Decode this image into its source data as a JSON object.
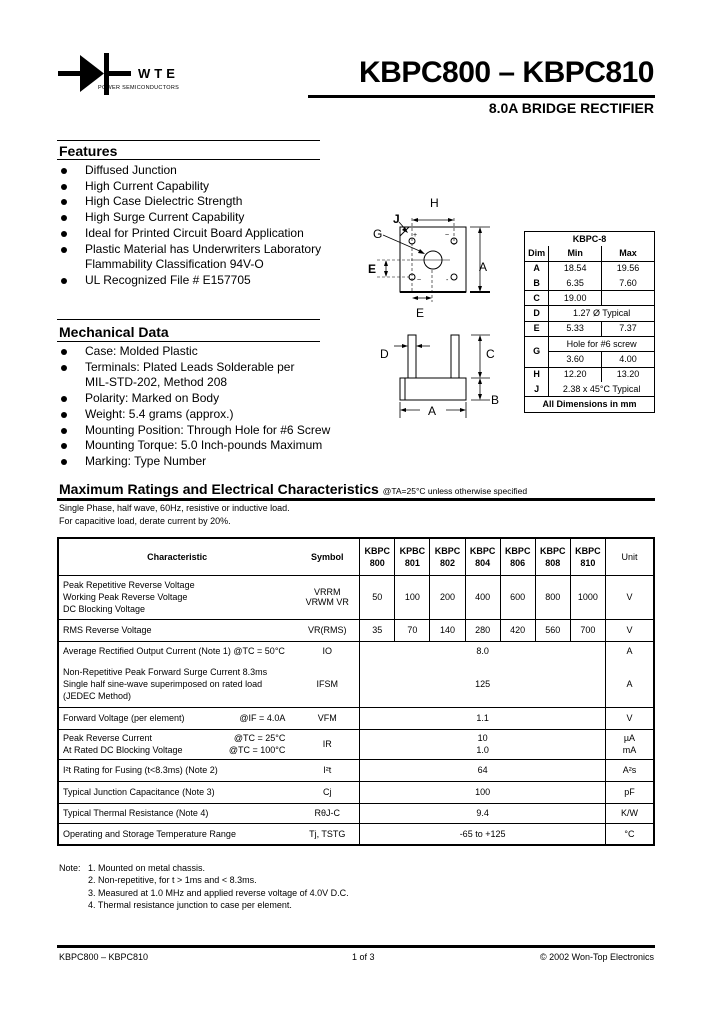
{
  "header": {
    "logo_text": "WTE",
    "logo_subtext": "POWER SEMICONDUCTORS",
    "title": "KBPC800 – KBPC810",
    "subtitle": "8.0A BRIDGE RECTIFIER"
  },
  "features": {
    "title": "Features",
    "items": [
      "Diffused Junction",
      "High Current Capability",
      "High Case Dielectric Strength",
      "High Surge Current Capability",
      "Ideal for Printed Circuit Board Application",
      "Plastic Material has Underwriters Laboratory\nFlammability Classification 94V-O",
      "UL Recognized File # E157705"
    ]
  },
  "mechanical": {
    "title": "Mechanical Data",
    "items": [
      "Case: Molded Plastic",
      "Terminals: Plated Leads Solderable per\nMIL-STD-202, Method 208",
      "Polarity: Marked on Body",
      "Weight: 5.4 grams (approx.)",
      "Mounting Position: Through Hole for #6 Screw",
      "Mounting Torque: 5.0 Inch-pounds Maximum",
      "Marking: Type Number"
    ]
  },
  "diagram": {
    "labels": {
      "H": "H",
      "J": "J",
      "G": "G",
      "E": "E",
      "A": "A",
      "D": "D",
      "C": "C",
      "B": "B"
    },
    "pin_marks": {
      "plus": "+",
      "tilde1": "~",
      "tilde2": "~",
      "minus": "-"
    }
  },
  "dim_table": {
    "package": "KBPC-8",
    "headers": [
      "Dim",
      "Min",
      "Max"
    ],
    "rows": [
      {
        "dim": "A",
        "min": "18.54",
        "max": "19.56"
      },
      {
        "dim": "B",
        "min": "6.35",
        "max": "7.60"
      },
      {
        "dim": "C",
        "min": "19.00",
        "max": ""
      },
      {
        "dim": "D",
        "span": "1.27 Ø Typical"
      },
      {
        "dim": "E",
        "min": "5.33",
        "max": "7.37"
      },
      {
        "dim": "G",
        "span": "Hole for #6 screw",
        "min": "3.60",
        "max": "4.00"
      },
      {
        "dim": "H",
        "min": "12.20",
        "max": "13.20"
      },
      {
        "dim": "J",
        "span": "2.38 x 45°C Typical"
      }
    ],
    "footer": "All Dimensions in mm"
  },
  "ratings": {
    "title": "Maximum Ratings and Electrical Characteristics",
    "condition": "@TA=25°C unless otherwise specified",
    "note1": "Single Phase, half wave, 60Hz, resistive or inductive load.",
    "note2": "For capacitive load, derate current by 20%.",
    "table": {
      "col_characteristic": "Characteristic",
      "col_symbol": "Symbol",
      "col_unit": "Unit",
      "parts": [
        {
          "l1": "KBPC",
          "l2": "800"
        },
        {
          "l1": "KPBC",
          "l2": "801"
        },
        {
          "l1": "KBPC",
          "l2": "802"
        },
        {
          "l1": "KBPC",
          "l2": "804"
        },
        {
          "l1": "KBPC",
          "l2": "806"
        },
        {
          "l1": "KBPC",
          "l2": "808"
        },
        {
          "l1": "KBPC",
          "l2": "810"
        }
      ],
      "rows": [
        {
          "char": [
            "Peak Repetitive Reverse Voltage",
            "Working Peak Reverse Voltage",
            "DC Blocking Voltage"
          ],
          "sym": [
            "VRRM",
            "VRWM",
            "VR"
          ],
          "values": [
            "50",
            "100",
            "200",
            "400",
            "600",
            "800",
            "1000"
          ],
          "unit": "V"
        },
        {
          "char": [
            "RMS Reverse Voltage"
          ],
          "sym": [
            "VR(RMS)"
          ],
          "values": [
            "35",
            "70",
            "140",
            "280",
            "420",
            "560",
            "700"
          ],
          "unit": "V"
        },
        {
          "char": [
            "Average Rectified Output Current (Note 1)  @TC = 50°C"
          ],
          "sym": [
            "IO"
          ],
          "value": "8.0",
          "unit": "A"
        },
        {
          "char": [
            "Non-Repetitive Peak Forward Surge Current 8.3ms",
            "Single half sine-wave superimposed on rated load",
            "(JEDEC Method)"
          ],
          "sym": [
            "IFSM"
          ],
          "value": "125",
          "unit": "A"
        },
        {
          "char": [
            "Forward Voltage (per element)"
          ],
          "cond": [
            "@IF = 4.0A"
          ],
          "sym": [
            "VFM"
          ],
          "value": "1.1",
          "unit": "V"
        },
        {
          "char": [
            "Peak Reverse Current",
            "At Rated DC Blocking Voltage"
          ],
          "cond": [
            "@TC = 25°C",
            "@TC = 100°C"
          ],
          "sym": [
            "IR"
          ],
          "value": "10\n1.0",
          "unit": "µA\nmA"
        },
        {
          "char": [
            "I²t Rating for Fusing (t<8.3ms) (Note 2)"
          ],
          "sym": [
            "I²t"
          ],
          "value": "64",
          "unit": "A²s"
        },
        {
          "char": [
            "Typical Junction Capacitance (Note 3)"
          ],
          "sym": [
            "Cj"
          ],
          "value": "100",
          "unit": "pF"
        },
        {
          "char": [
            "Typical Thermal Resistance (Note 4)"
          ],
          "sym": [
            "RθJ-C"
          ],
          "value": "9.4",
          "unit": "K/W"
        },
        {
          "char": [
            "Operating and Storage Temperature Range"
          ],
          "sym": [
            "Tj, TSTG"
          ],
          "value": "-65 to +125",
          "unit": "°C"
        }
      ]
    }
  },
  "notes": {
    "label": "Note:",
    "items": [
      "1. Mounted on metal chassis.",
      "2. Non-repetitive, for t > 1ms and < 8.3ms.",
      "3. Measured at 1.0 MHz and applied reverse voltage of 4.0V D.C.",
      "4. Thermal resistance junction to case per element."
    ]
  },
  "footer": {
    "left": "KBPC800 – KBPC810",
    "center": "1 of 3",
    "right": "© 2002 Won-Top Electronics"
  }
}
